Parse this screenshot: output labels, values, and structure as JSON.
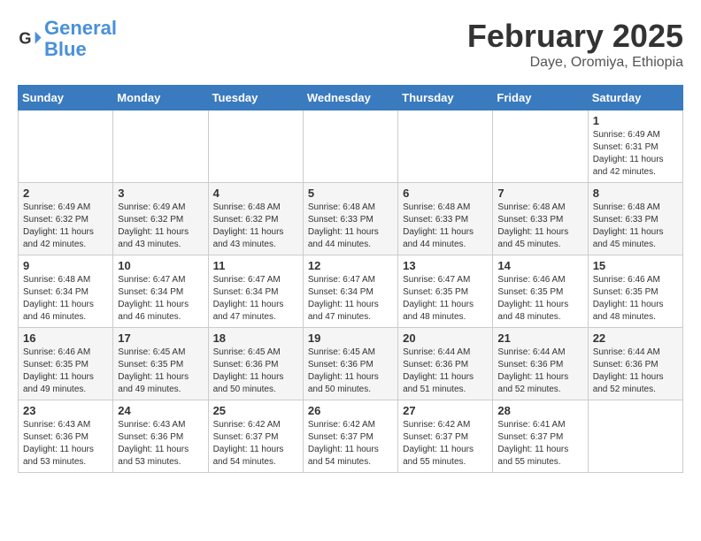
{
  "header": {
    "logo_general": "General",
    "logo_blue": "Blue",
    "month_title": "February 2025",
    "location": "Daye, Oromiya, Ethiopia"
  },
  "days_of_week": [
    "Sunday",
    "Monday",
    "Tuesday",
    "Wednesday",
    "Thursday",
    "Friday",
    "Saturday"
  ],
  "weeks": [
    {
      "row_class": "row-odd",
      "days": [
        {
          "num": "",
          "empty": true
        },
        {
          "num": "",
          "empty": true
        },
        {
          "num": "",
          "empty": true
        },
        {
          "num": "",
          "empty": true
        },
        {
          "num": "",
          "empty": true
        },
        {
          "num": "",
          "empty": true
        },
        {
          "num": "1",
          "sunrise": "6:49 AM",
          "sunset": "6:31 PM",
          "daylight": "11 hours and 42 minutes."
        }
      ]
    },
    {
      "row_class": "row-even",
      "days": [
        {
          "num": "2",
          "sunrise": "6:49 AM",
          "sunset": "6:32 PM",
          "daylight": "11 hours and 42 minutes."
        },
        {
          "num": "3",
          "sunrise": "6:49 AM",
          "sunset": "6:32 PM",
          "daylight": "11 hours and 43 minutes."
        },
        {
          "num": "4",
          "sunrise": "6:48 AM",
          "sunset": "6:32 PM",
          "daylight": "11 hours and 43 minutes."
        },
        {
          "num": "5",
          "sunrise": "6:48 AM",
          "sunset": "6:33 PM",
          "daylight": "11 hours and 44 minutes."
        },
        {
          "num": "6",
          "sunrise": "6:48 AM",
          "sunset": "6:33 PM",
          "daylight": "11 hours and 44 minutes."
        },
        {
          "num": "7",
          "sunrise": "6:48 AM",
          "sunset": "6:33 PM",
          "daylight": "11 hours and 45 minutes."
        },
        {
          "num": "8",
          "sunrise": "6:48 AM",
          "sunset": "6:33 PM",
          "daylight": "11 hours and 45 minutes."
        }
      ]
    },
    {
      "row_class": "row-odd",
      "days": [
        {
          "num": "9",
          "sunrise": "6:48 AM",
          "sunset": "6:34 PM",
          "daylight": "11 hours and 46 minutes."
        },
        {
          "num": "10",
          "sunrise": "6:47 AM",
          "sunset": "6:34 PM",
          "daylight": "11 hours and 46 minutes."
        },
        {
          "num": "11",
          "sunrise": "6:47 AM",
          "sunset": "6:34 PM",
          "daylight": "11 hours and 47 minutes."
        },
        {
          "num": "12",
          "sunrise": "6:47 AM",
          "sunset": "6:34 PM",
          "daylight": "11 hours and 47 minutes."
        },
        {
          "num": "13",
          "sunrise": "6:47 AM",
          "sunset": "6:35 PM",
          "daylight": "11 hours and 48 minutes."
        },
        {
          "num": "14",
          "sunrise": "6:46 AM",
          "sunset": "6:35 PM",
          "daylight": "11 hours and 48 minutes."
        },
        {
          "num": "15",
          "sunrise": "6:46 AM",
          "sunset": "6:35 PM",
          "daylight": "11 hours and 48 minutes."
        }
      ]
    },
    {
      "row_class": "row-even",
      "days": [
        {
          "num": "16",
          "sunrise": "6:46 AM",
          "sunset": "6:35 PM",
          "daylight": "11 hours and 49 minutes."
        },
        {
          "num": "17",
          "sunrise": "6:45 AM",
          "sunset": "6:35 PM",
          "daylight": "11 hours and 49 minutes."
        },
        {
          "num": "18",
          "sunrise": "6:45 AM",
          "sunset": "6:36 PM",
          "daylight": "11 hours and 50 minutes."
        },
        {
          "num": "19",
          "sunrise": "6:45 AM",
          "sunset": "6:36 PM",
          "daylight": "11 hours and 50 minutes."
        },
        {
          "num": "20",
          "sunrise": "6:44 AM",
          "sunset": "6:36 PM",
          "daylight": "11 hours and 51 minutes."
        },
        {
          "num": "21",
          "sunrise": "6:44 AM",
          "sunset": "6:36 PM",
          "daylight": "11 hours and 52 minutes."
        },
        {
          "num": "22",
          "sunrise": "6:44 AM",
          "sunset": "6:36 PM",
          "daylight": "11 hours and 52 minutes."
        }
      ]
    },
    {
      "row_class": "row-odd",
      "days": [
        {
          "num": "23",
          "sunrise": "6:43 AM",
          "sunset": "6:36 PM",
          "daylight": "11 hours and 53 minutes."
        },
        {
          "num": "24",
          "sunrise": "6:43 AM",
          "sunset": "6:36 PM",
          "daylight": "11 hours and 53 minutes."
        },
        {
          "num": "25",
          "sunrise": "6:42 AM",
          "sunset": "6:37 PM",
          "daylight": "11 hours and 54 minutes."
        },
        {
          "num": "26",
          "sunrise": "6:42 AM",
          "sunset": "6:37 PM",
          "daylight": "11 hours and 54 minutes."
        },
        {
          "num": "27",
          "sunrise": "6:42 AM",
          "sunset": "6:37 PM",
          "daylight": "11 hours and 55 minutes."
        },
        {
          "num": "28",
          "sunrise": "6:41 AM",
          "sunset": "6:37 PM",
          "daylight": "11 hours and 55 minutes."
        },
        {
          "num": "",
          "empty": true
        }
      ]
    }
  ]
}
